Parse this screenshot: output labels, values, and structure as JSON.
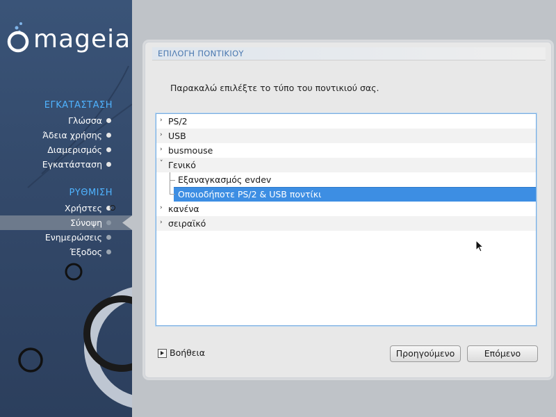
{
  "sidebar": {
    "logo_text": "mageia",
    "sections": [
      {
        "title": "ΕΓΚΑΤΑΣΤΑΣΗ",
        "steps": [
          {
            "label": "Γλώσσα",
            "state": "done"
          },
          {
            "label": "Άδεια χρήσης",
            "state": "done"
          },
          {
            "label": "Διαμερισμός",
            "state": "done"
          },
          {
            "label": "Εγκατάσταση",
            "state": "done"
          }
        ]
      },
      {
        "title": "ΡΥΘΜΙΣΗ",
        "steps": [
          {
            "label": "Χρήστες",
            "state": "done"
          },
          {
            "label": "Σύνοψη",
            "state": "active"
          },
          {
            "label": "Ενημερώσεις",
            "state": "pending"
          },
          {
            "label": "Έξοδος",
            "state": "pending"
          }
        ]
      }
    ]
  },
  "dialog": {
    "title": "ΕΠΙΛΟΓΗ ΠΟΝΤΙΚΙΟΥ",
    "prompt": "Παρακαλώ επιλέξτε το τύπο του ποντικιού σας.",
    "tree": [
      {
        "label": "PS/2",
        "expander": "collapsed",
        "level": 0
      },
      {
        "label": "USB",
        "expander": "collapsed",
        "level": 0
      },
      {
        "label": "busmouse",
        "expander": "collapsed",
        "level": 0
      },
      {
        "label": "Γενικό",
        "expander": "expanded",
        "level": 0
      },
      {
        "label": "Εξαναγκασμός evdev",
        "expander": "none",
        "level": 1
      },
      {
        "label": "Οποιοδήποτε PS/2 & USB ποντίκι",
        "expander": "none",
        "level": 1,
        "selected": true
      },
      {
        "label": "κανένα",
        "expander": "collapsed",
        "level": 0
      },
      {
        "label": "σειραϊκό",
        "expander": "collapsed",
        "level": 0
      }
    ],
    "help_label": "Βοήθεια",
    "back_label": "Προηγούμενο",
    "next_label": "Επόμενο"
  },
  "colors": {
    "sidebar_bg": "#33496a",
    "section_title": "#4fb3ff",
    "selection": "#3d8ee3",
    "dialog_title": "#4a78b0"
  }
}
